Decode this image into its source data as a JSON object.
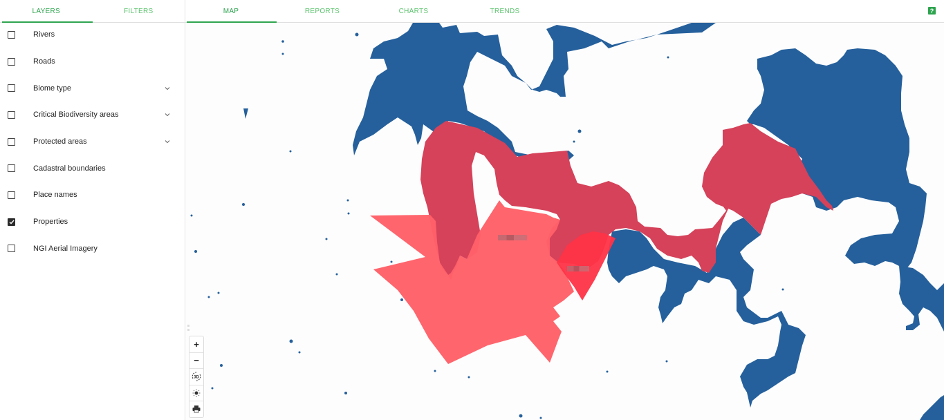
{
  "sidebar": {
    "tabs": [
      {
        "label": "LAYERS",
        "active": true
      },
      {
        "label": "FILTERS",
        "active": false
      }
    ],
    "layers": [
      {
        "label": "Rivers",
        "checked": false,
        "expandable": false
      },
      {
        "label": "Roads",
        "checked": false,
        "expandable": false
      },
      {
        "label": "Biome type",
        "checked": false,
        "expandable": true
      },
      {
        "label": "Critical Biodiversity areas",
        "checked": false,
        "expandable": true
      },
      {
        "label": "Protected areas",
        "checked": false,
        "expandable": true
      },
      {
        "label": "Cadastral boundaries",
        "checked": false,
        "expandable": false
      },
      {
        "label": "Place names",
        "checked": false,
        "expandable": false
      },
      {
        "label": "Properties",
        "checked": true,
        "expandable": false
      },
      {
        "label": "NGI Aerial Imagery",
        "checked": false,
        "expandable": false
      }
    ]
  },
  "topnav": {
    "tabs": [
      {
        "label": "MAP",
        "active": true
      },
      {
        "label": "REPORTS",
        "active": false
      },
      {
        "label": "CHARTS",
        "active": false
      },
      {
        "label": "TRENDS",
        "active": false
      }
    ],
    "help_label": "?"
  },
  "map": {
    "controls": {
      "zoom_in": "+",
      "zoom_out": "−",
      "toggle_3d": "3D",
      "light_icon": "sun-icon",
      "print_icon": "printer-icon"
    },
    "colors": {
      "water": "#25609c",
      "protected_area": "#d5425a",
      "property": "#ff6068",
      "property_selected": "#ff3347",
      "accent": "#2ea44f"
    }
  }
}
